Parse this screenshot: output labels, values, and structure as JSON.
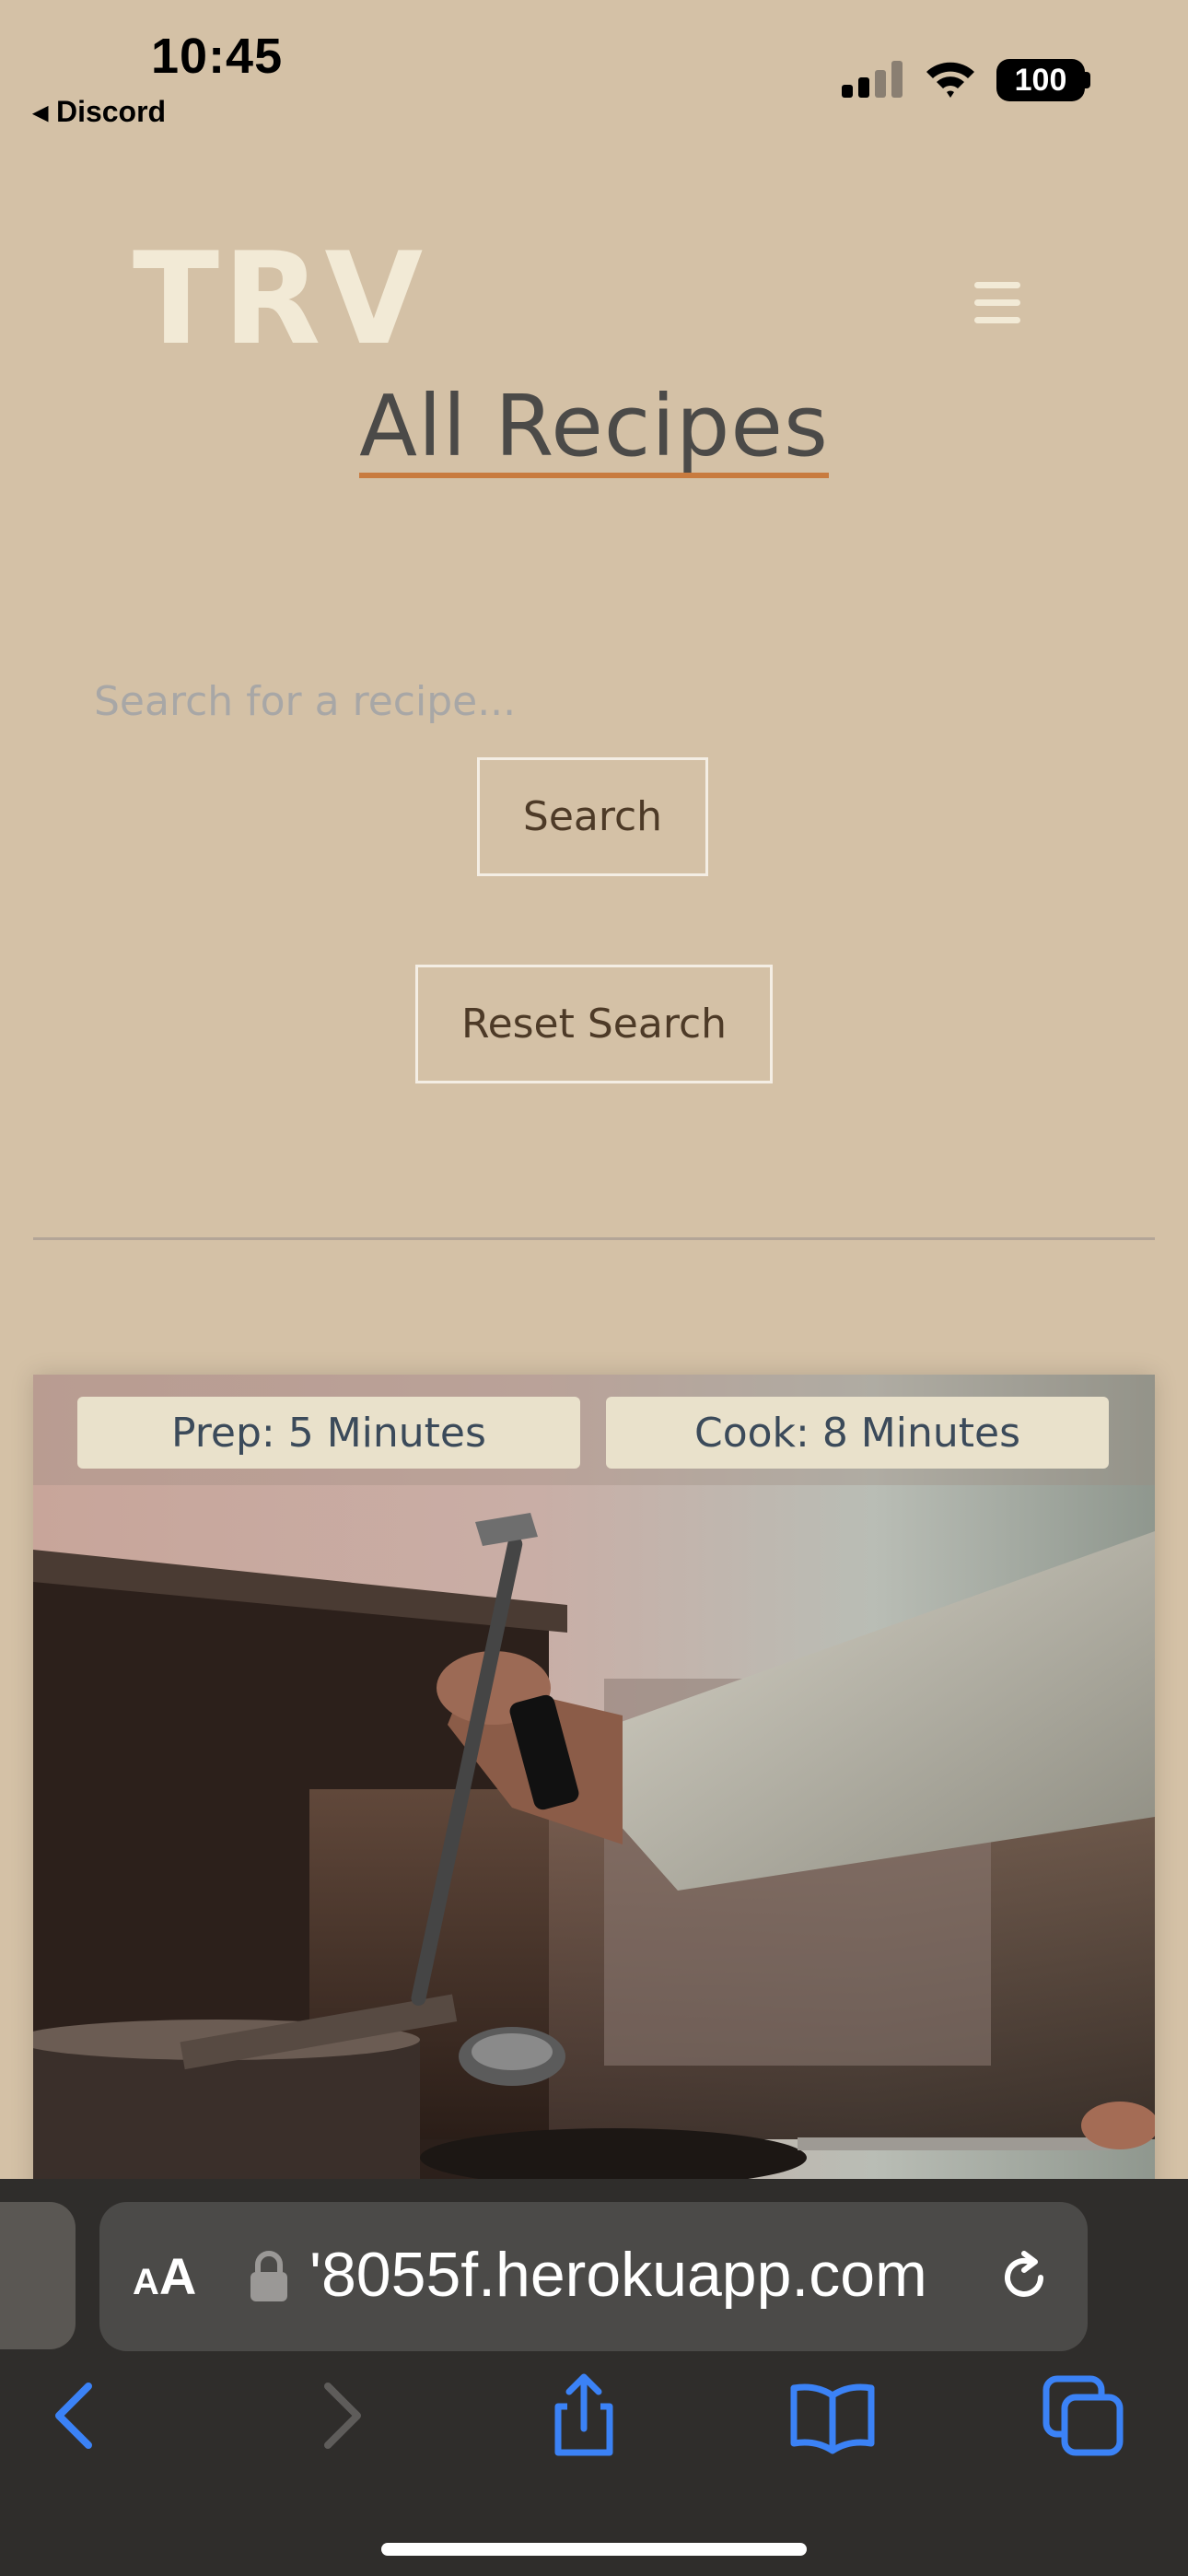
{
  "status_bar": {
    "time": "10:45",
    "back_app": "◂ Discord",
    "battery": "100"
  },
  "header": {
    "logo": "TRV",
    "menu_icon": "hamburger-menu-icon"
  },
  "page": {
    "title": "All Recipes",
    "accent_color": "#c87b3f"
  },
  "search": {
    "placeholder": "Search for a recipe...",
    "value": "",
    "search_label": "Search",
    "reset_label": "Reset Search"
  },
  "recipes": [
    {
      "prep": "Prep: 5 Minutes",
      "cook": "Cook: 8 Minutes",
      "image": "chef-cooking-photo"
    }
  ],
  "browser": {
    "text_size_label": "AA",
    "url": "'8055f.herokuapp.com",
    "icons": [
      "back-arrow-icon",
      "forward-arrow-icon",
      "share-icon",
      "bookmarks-icon",
      "tabs-icon"
    ]
  },
  "colors": {
    "background": "#d4c1a6",
    "logo": "#f2ead6",
    "button_text": "#4d3a27",
    "browser_blue": "#3b82f6"
  }
}
